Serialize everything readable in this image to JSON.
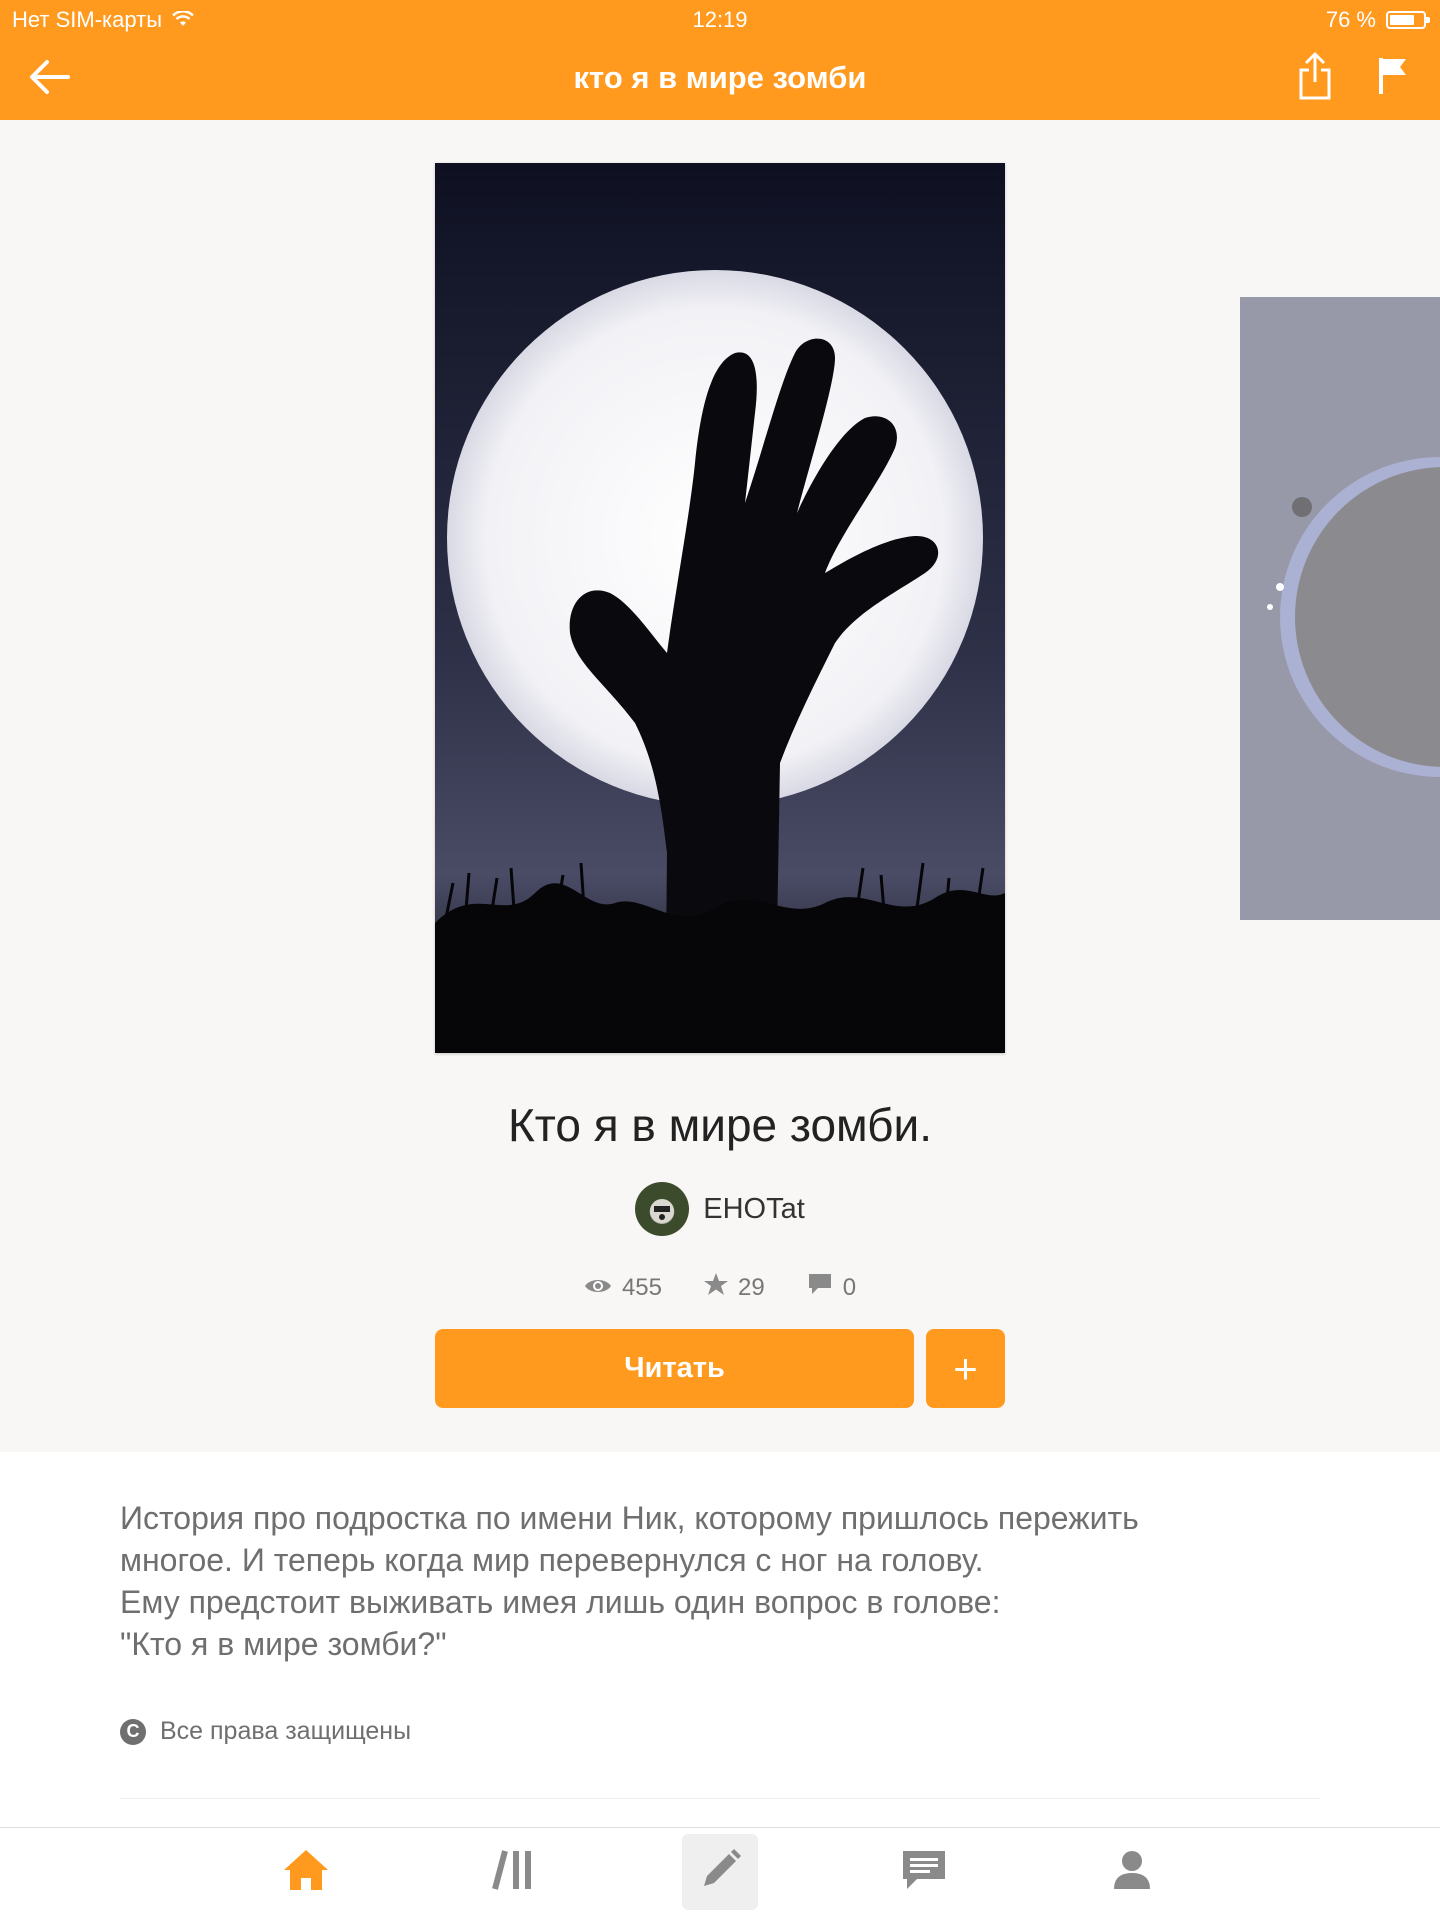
{
  "status": {
    "carrier": "Нет SIM-карты",
    "time": "12:19",
    "battery": "76 %",
    "battery_level": 0.76
  },
  "header": {
    "title": "кто я в мире зомби"
  },
  "book": {
    "title": "Кто я в мире зомби.",
    "author": "EHOTat",
    "views": "455",
    "votes": "29",
    "comments": "0",
    "read_label": "Читать",
    "add_label": "+"
  },
  "description": {
    "lines": [
      "История про подростка по имени Ник, которому пришлось пережить",
      "многое. И теперь когда мир перевернулся с ног на голову.",
      "Ему предстоит выживать имея лишь один вопрос в голове:",
      "\"Кто я в мире зомби?\""
    ],
    "copyright": "Все права защищены"
  },
  "colors": {
    "accent": "#FF9A1F",
    "icon_gray": "#8a8a8a",
    "text_gray": "#6f6f6f"
  },
  "icons": {
    "back": "arrow-left-icon",
    "share": "share-icon",
    "flag": "flag-icon",
    "views": "eye-icon",
    "votes": "star-icon",
    "comments": "comment-icon",
    "copyright": "copyright-icon",
    "tabs": [
      "home-icon",
      "library-icon",
      "write-icon",
      "messages-icon",
      "profile-icon"
    ]
  },
  "tabbar": {
    "active": "home"
  }
}
